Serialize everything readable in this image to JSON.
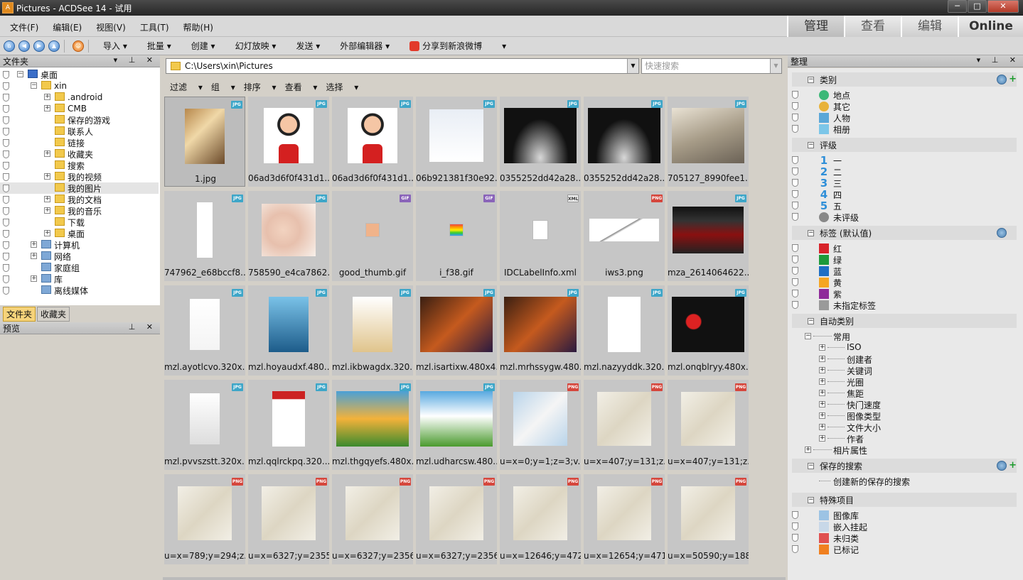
{
  "window": {
    "title": "Pictures - ACDSee 14 - 试用",
    "controls": {
      "minimize": "─",
      "maximize": "□",
      "close": "✕"
    }
  },
  "menu": [
    "文件(F)",
    "编辑(E)",
    "视图(V)",
    "工具(T)",
    "帮助(H)"
  ],
  "mode_tabs": [
    "管理",
    "查看",
    "编辑",
    "Online"
  ],
  "toolbar": {
    "import": "导入",
    "batch": "批量",
    "create": "创建",
    "slideshow": "幻灯放映",
    "send": "发送",
    "external_editor": "外部编辑器",
    "share_weibo": "分享到新浪微博"
  },
  "folders_panel": {
    "title": "文件夹",
    "tree": [
      "桌面",
      "xin",
      ".android",
      "CMB",
      "保存的游戏",
      "联系人",
      "链接",
      "收藏夹",
      "搜索",
      "我的视频",
      "我的图片",
      "我的文档",
      "我的音乐",
      "下载",
      "桌面",
      "计算机",
      "网络",
      "家庭组",
      "库",
      "离线媒体"
    ],
    "tabs": [
      "文件夹",
      "收藏夹"
    ]
  },
  "preview_panel": {
    "title": "预览"
  },
  "path": {
    "value": "C:\\Users\\xin\\Pictures",
    "search_placeholder": "快速搜索"
  },
  "subtoolbar": [
    "过滤",
    "组",
    "排序",
    "查看",
    "选择"
  ],
  "files": [
    {
      "name": "1.jpg",
      "type": "JPG"
    },
    {
      "name": "06ad3d6f0f431d1...",
      "type": "JPG"
    },
    {
      "name": "06ad3d6f0f431d1...",
      "type": "JPG"
    },
    {
      "name": "06b921381f30e92...",
      "type": "JPG"
    },
    {
      "name": "0355252dd42a28...",
      "type": "JPG"
    },
    {
      "name": "0355252dd42a28...",
      "type": "JPG"
    },
    {
      "name": "705127_8990fee1...",
      "type": "JPG"
    },
    {
      "name": "747962_e68bccf8...",
      "type": "JPG"
    },
    {
      "name": "758590_e4ca7862...",
      "type": "JPG"
    },
    {
      "name": "good_thumb.gif",
      "type": "GIF"
    },
    {
      "name": "i_f38.gif",
      "type": "GIF"
    },
    {
      "name": "IDCLabelInfo.xml",
      "type": "XML"
    },
    {
      "name": "iws3.png",
      "type": "PNG"
    },
    {
      "name": "mza_2614064622...",
      "type": "JPG"
    },
    {
      "name": "mzl.ayotlcvo.320x...",
      "type": "JPG"
    },
    {
      "name": "mzl.hoyaudxf.480...",
      "type": "JPG"
    },
    {
      "name": "mzl.ikbwagdx.320...",
      "type": "JPG"
    },
    {
      "name": "mzl.isartixw.480x4...",
      "type": "JPG"
    },
    {
      "name": "mzl.mrhssygw.480...",
      "type": "JPG"
    },
    {
      "name": "mzl.nazyyddk.320...",
      "type": "JPG"
    },
    {
      "name": "mzl.onqblryy.480x...",
      "type": "JPG"
    },
    {
      "name": "mzl.pvvszstt.320x...",
      "type": "JPG"
    },
    {
      "name": "mzl.qqlrckpq.320...",
      "type": "JPG"
    },
    {
      "name": "mzl.thgqyefs.480x...",
      "type": "JPG"
    },
    {
      "name": "mzl.udharcsw.480...",
      "type": "JPG"
    },
    {
      "name": "u=x=0;y=1;z=3;v...",
      "type": "PNG"
    },
    {
      "name": "u=x=407;y=131;z...",
      "type": "PNG"
    },
    {
      "name": "u=x=407;y=131;z...",
      "type": "PNG"
    },
    {
      "name": "u=x=789;y=294;z...",
      "type": "PNG"
    },
    {
      "name": "u=x=6327;y=2355...",
      "type": "PNG"
    },
    {
      "name": "u=x=6327;y=2356...",
      "type": "PNG"
    },
    {
      "name": "u=x=6327;y=2356...",
      "type": "PNG"
    },
    {
      "name": "u=x=12646;y=472...",
      "type": "PNG"
    },
    {
      "name": "u=x=12654;y=471...",
      "type": "PNG"
    },
    {
      "name": "u=x=50590;y=188...",
      "type": "PNG"
    }
  ],
  "organize_panel": {
    "title": "整理",
    "categories": {
      "title": "类别",
      "items": [
        "地点",
        "其它",
        "人物",
        "相册"
      ]
    },
    "ratings": {
      "title": "评级",
      "items": [
        {
          "num": "1",
          "label": "一"
        },
        {
          "num": "2",
          "label": "二"
        },
        {
          "num": "3",
          "label": "三"
        },
        {
          "num": "4",
          "label": "四"
        },
        {
          "num": "5",
          "label": "五"
        }
      ],
      "unrated": "未评级"
    },
    "labels": {
      "title": "标签 (默认值)",
      "items": [
        {
          "label": "红",
          "color": "#d8232a"
        },
        {
          "label": "绿",
          "color": "#1e9a3a"
        },
        {
          "label": "蓝",
          "color": "#1f6fc4"
        },
        {
          "label": "黄",
          "color": "#f5a623"
        },
        {
          "label": "紫",
          "color": "#8e2a9a"
        },
        {
          "label": "未指定标签",
          "color": "#9a9a9a"
        }
      ]
    },
    "auto_categories": {
      "title": "自动类别",
      "common": "常用",
      "items": [
        "ISO",
        "创建者",
        "关键词",
        "光圈",
        "焦距",
        "快门速度",
        "图像类型",
        "文件大小",
        "作者"
      ],
      "photo_props": "相片属性"
    },
    "saved_searches": {
      "title": "保存的搜索",
      "create": "创建新的保存的搜索"
    },
    "special": {
      "title": "特殊项目",
      "items": [
        "图像库",
        "嵌入挂起",
        "未归类",
        "已标记"
      ]
    }
  }
}
